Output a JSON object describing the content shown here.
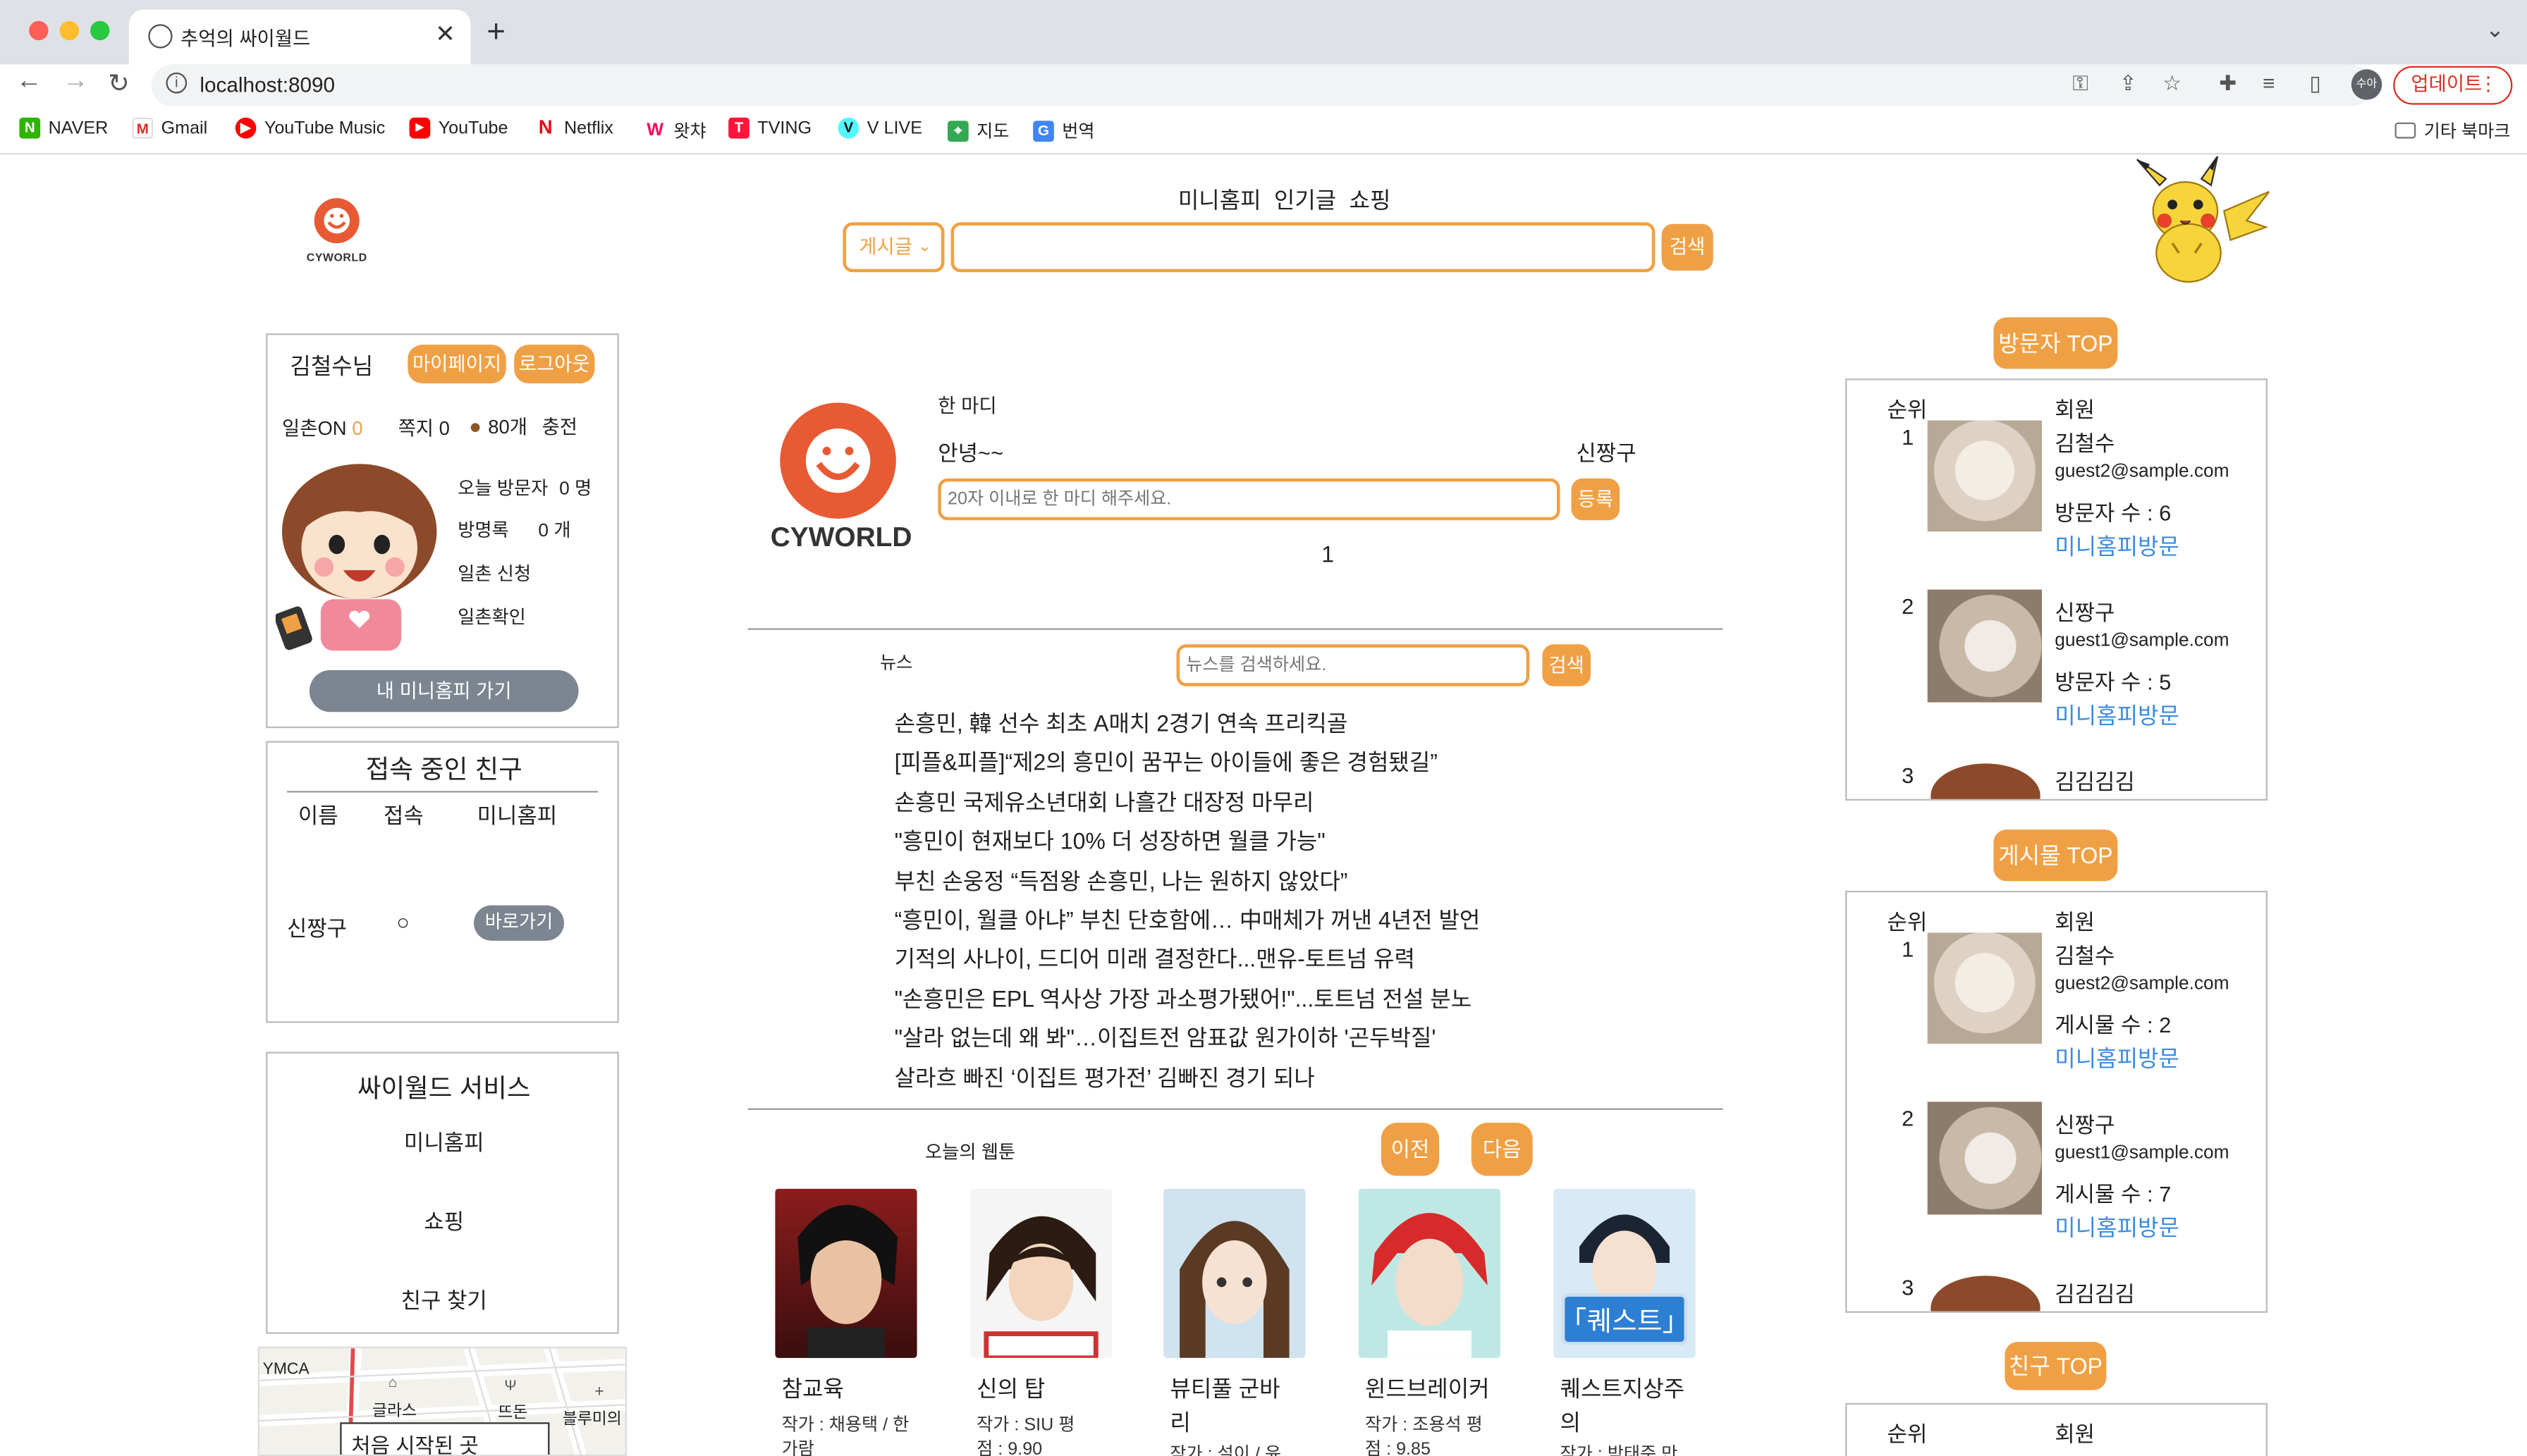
{
  "browser": {
    "tab_title": "추억의 싸이월드",
    "url": "localhost:8090",
    "update_label": "업데이트",
    "profile_initials": "수아",
    "bookmarks": [
      "NAVER",
      "Gmail",
      "YouTube Music",
      "YouTube",
      "Netflix",
      "왓챠",
      "TVING",
      "V LIVE",
      "지도",
      "번역"
    ],
    "other_bookmarks": "기타 북마크"
  },
  "header": {
    "logo_text": "CYWORLD",
    "nav": [
      "미니홈피",
      "인기글",
      "쇼핑"
    ],
    "search_select": "게시글",
    "search_button": "검색"
  },
  "user": {
    "name": "김철수님",
    "mypage": "마이페이지",
    "logout": "로그아웃",
    "ilchon_label": "일촌ON",
    "ilchon_value": "0",
    "note_label": "쪽지 0",
    "acorn": "80개",
    "charge": "충전",
    "today_visitors_label": "오늘 방문자",
    "today_visitors_value": "0 명",
    "guestbook_label": "방명록",
    "guestbook_value": "0 개",
    "ilchon_request": "일촌 신청",
    "ilchon_check": "일촌확인",
    "go_minihome": "내 미니홈피 가기"
  },
  "friends": {
    "title": "접속 중인 친구",
    "headers": [
      "이름",
      "접속",
      "미니홈피"
    ],
    "rows": [
      {
        "name": "신짱구",
        "status": "○",
        "action": "바로가기"
      }
    ]
  },
  "services": {
    "title": "싸이월드 서비스",
    "items": [
      "미니홈피",
      "쇼핑",
      "친구 찾기"
    ]
  },
  "map": {
    "labels": [
      "YMCA",
      "글라스",
      "뜨돈",
      "블루미의"
    ],
    "caption": "처음 시작된 곳"
  },
  "oneline": {
    "title": "한 마디",
    "message": "안녕~~",
    "author": "신짱구",
    "placeholder": "20자 이내로 한 마디 해주세요.",
    "submit": "등록",
    "page": "1",
    "logo_text": "CYWORLD"
  },
  "news": {
    "label": "뉴스",
    "placeholder": "뉴스를 검색하세요.",
    "search": "검색",
    "items": [
      "손흥민, 韓 선수 최초 A매치 2경기 연속 프리킥골",
      "[피플&피플]“제2의 흥민이 꿈꾸는 아이들에 좋은 경험됐길”",
      "손흥민 국제유소년대회 나흘간 대장정 마무리",
      "\"흥민이 현재보다 10% 더 성장하면 월클 가능\"",
      "부친 손웅정 “득점왕 손흥민, 나는 원하지 않았다”",
      "“흥민이, 월클 아냐” 부친 단호함에… 中매체가 꺼낸 4년전 발언",
      "기적의 사나이, 드디어 미래 결정한다...맨유-토트넘 유력",
      "\"손흥민은 EPL 역사상 가장 과소평가됐어!\"...토트넘 전설 분노",
      "\"살라 없는데 왜 봐\"…이집트전 암표값 원가이하 '곤두박질'",
      "살라흐 빠진 ‘이집트 평가전’ 김빠진 경기 되나"
    ]
  },
  "webtoon": {
    "label": "오늘의 웹툰",
    "prev": "이전",
    "next": "다음",
    "items": [
      {
        "title": "참교육",
        "sub": "작가 : 채용택 / 한가람"
      },
      {
        "title": "신의 탑",
        "sub": "작가 : SIU 평점 : 9.90"
      },
      {
        "title": "뷰티풀 군바리",
        "sub": "작가 : 설이 / 윤..."
      },
      {
        "title": "윈드브레이커",
        "sub": "작가 : 조용석 평점 : 9.85"
      },
      {
        "title": "퀘스트지상주의",
        "sub": "작가 : 박태준 만..."
      }
    ]
  },
  "rank_visitors": {
    "title": "방문자 TOP",
    "headers": [
      "순위",
      "회원"
    ],
    "items": [
      {
        "rank": "1",
        "name": "김철수",
        "email": "guest2@sample.com",
        "stat": "방문자 수 : 6",
        "link": "미니홈피방문"
      },
      {
        "rank": "2",
        "name": "신짱구",
        "email": "guest1@sample.com",
        "stat": "방문자 수 : 5",
        "link": "미니홈피방문"
      },
      {
        "rank": "3",
        "name": "김김김김"
      }
    ]
  },
  "rank_posts": {
    "title": "게시물 TOP",
    "headers": [
      "순위",
      "회원"
    ],
    "items": [
      {
        "rank": "1",
        "name": "김철수",
        "email": "guest2@sample.com",
        "stat": "게시물 수 : 2",
        "link": "미니홈피방문"
      },
      {
        "rank": "2",
        "name": "신짱구",
        "email": "guest1@sample.com",
        "stat": "게시물 수 : 7",
        "link": "미니홈피방문"
      },
      {
        "rank": "3",
        "name": "김김김김"
      }
    ]
  },
  "rank_friends": {
    "title": "친구 TOP",
    "headers": [
      "순위",
      "회원"
    ]
  },
  "colors": {
    "accent": "#f0a044",
    "logo_red": "#e85a33",
    "link": "#3a8be0",
    "gray_button": "#7c8590"
  }
}
